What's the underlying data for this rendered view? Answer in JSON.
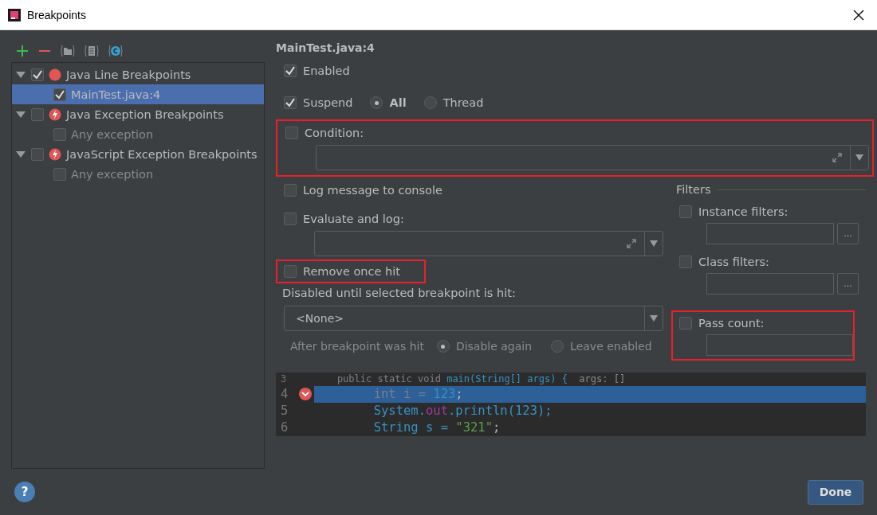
{
  "window": {
    "title": "Breakpoints"
  },
  "tree": [
    {
      "label": "Java Line Breakpoints",
      "kind": "line",
      "checked": true,
      "expanded": true,
      "selected": false,
      "children": [
        {
          "label": "MainTest.java:4",
          "checked": true,
          "selected": true
        }
      ]
    },
    {
      "label": "Java Exception Breakpoints",
      "kind": "exception",
      "checked": false,
      "expanded": true,
      "selected": false,
      "children": [
        {
          "label": "Any exception",
          "checked": false,
          "selected": false
        }
      ]
    },
    {
      "label": "JavaScript Exception Breakpoints",
      "kind": "exception",
      "checked": false,
      "expanded": true,
      "selected": false,
      "children": [
        {
          "label": "Any exception",
          "checked": false,
          "selected": false
        }
      ]
    }
  ],
  "details": {
    "heading": "MainTest.java:4",
    "enabled": {
      "label": "Enabled",
      "checked": true
    },
    "suspend": {
      "label": "Suspend",
      "checked": true,
      "options": [
        {
          "label": "All",
          "selected": true
        },
        {
          "label": "Thread",
          "selected": false
        }
      ]
    },
    "condition": {
      "label": "Condition:",
      "checked": false,
      "highlighted": true
    },
    "log_message": {
      "label": "Log message to console",
      "checked": false
    },
    "evaluate": {
      "label": "Evaluate and log:",
      "checked": false
    },
    "remove_once_hit": {
      "label": "Remove once hit",
      "checked": false,
      "highlighted": true
    },
    "disabled_until": {
      "label": "Disabled until selected breakpoint is hit:",
      "value": "<None>"
    },
    "after_hit": {
      "label": "After breakpoint was hit",
      "options": [
        {
          "label": "Disable again",
          "selected": true
        },
        {
          "label": "Leave enabled",
          "selected": false
        }
      ]
    },
    "filters": {
      "title": "Filters",
      "items": [
        {
          "label": "Instance filters:",
          "checked": false,
          "browse": "...",
          "highlighted": false
        },
        {
          "label": "Class filters:",
          "checked": false,
          "browse": "...",
          "highlighted": false
        },
        {
          "label": "Pass count:",
          "checked": false,
          "highlighted": true
        }
      ]
    }
  },
  "code": [
    {
      "number": "3",
      "selected": false,
      "breakpoint": false,
      "tokens": [
        {
          "text": "    public static void ",
          "kind": "keyword"
        },
        {
          "text": "main(String[] args) {",
          "kind": "plain"
        },
        {
          "text": "  args: []",
          "kind": "hint"
        }
      ]
    },
    {
      "number": "4",
      "selected": true,
      "breakpoint": true,
      "tokens": [
        {
          "text": "        int i = ",
          "kind": "keyword"
        },
        {
          "text": "123",
          "kind": "number"
        },
        {
          "text": ";",
          "kind": "punct"
        }
      ]
    },
    {
      "number": "5",
      "selected": false,
      "breakpoint": false,
      "tokens": [
        {
          "text": "        System.",
          "kind": "plain"
        },
        {
          "text": "out",
          "kind": "field"
        },
        {
          "text": ".println(123);",
          "kind": "plain"
        }
      ]
    },
    {
      "number": "6",
      "selected": false,
      "breakpoint": false,
      "tokens": [
        {
          "text": "        String s = ",
          "kind": "plain"
        },
        {
          "text": "\"321\"",
          "kind": "string"
        },
        {
          "text": ";",
          "kind": "punct"
        }
      ]
    }
  ],
  "help": "?",
  "done": "Done"
}
